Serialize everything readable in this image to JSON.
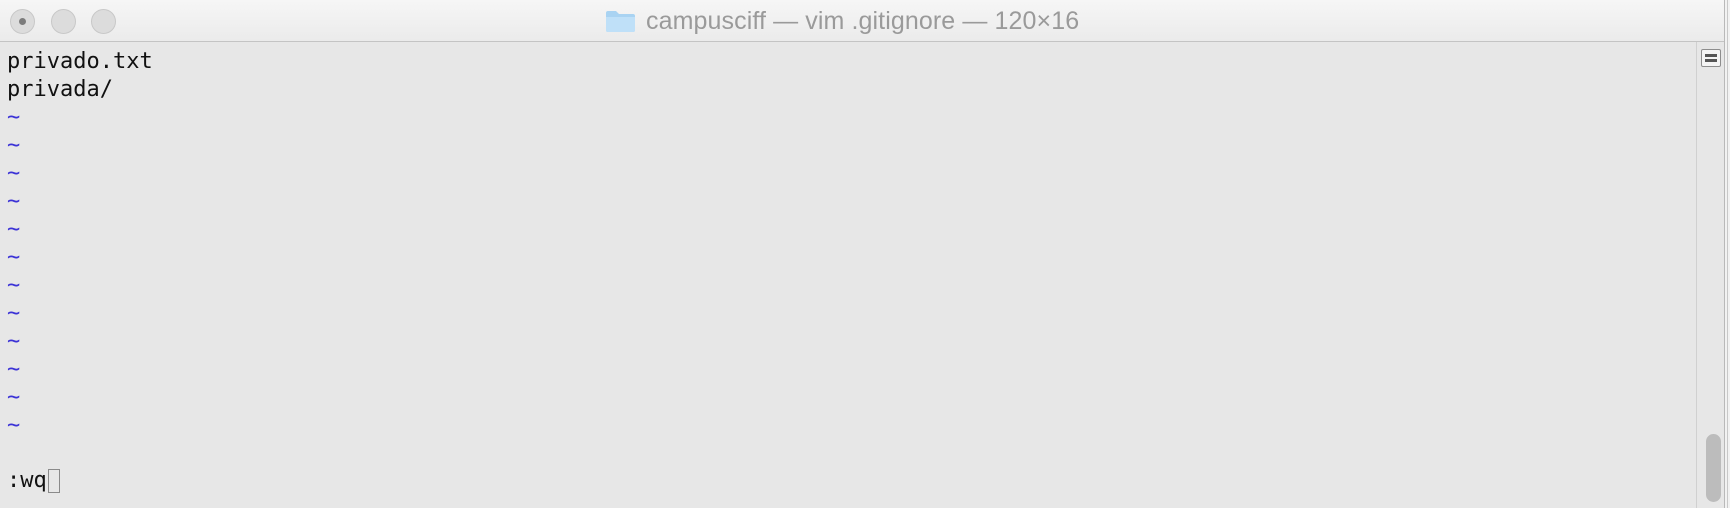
{
  "window": {
    "title": "campusciff — vim .gitignore — 120×16",
    "folder_icon": "folder-icon"
  },
  "editor": {
    "lines": [
      "privado.txt",
      "privada/"
    ],
    "empty_line_marker": "~",
    "command_line": ":wq"
  },
  "colors": {
    "tilde": "#3b32d6",
    "background": "#e7e7e7",
    "text": "#111111"
  }
}
